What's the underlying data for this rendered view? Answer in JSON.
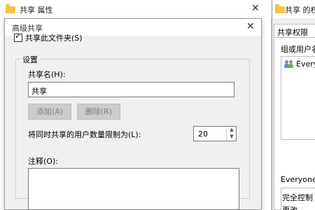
{
  "background_window": {
    "title": "共享 属性",
    "close_glyph": "✕"
  },
  "dialog": {
    "title": "高级共享",
    "close_glyph": "✕",
    "share_checkbox": {
      "label": "共享此文件夹(S)",
      "checked": true,
      "mark": "✓"
    },
    "settings_group_title": "设置",
    "share_name_label": "共享名(H):",
    "share_name_value": "共享",
    "add_button": "添加(A)",
    "remove_button": "删除(R)",
    "limit_label": "将同时共享的用户数量限制为(L):",
    "limit_value": "20",
    "spin_up": "▲",
    "spin_down": "▼",
    "comment_label": "注释(O):",
    "comment_value": ""
  },
  "right_window": {
    "title": "共享 的权",
    "tab_label": "共享权限",
    "group_users_label": "组或用户名",
    "user_item": "Every",
    "permissions_label": "Everyone",
    "permission_rows": [
      "完全控制",
      "更改"
    ]
  },
  "colors": {
    "dialog_bg": "#f0f0f0",
    "folder_yellow": "#f5c542",
    "disabled_button": "#cccccc"
  }
}
